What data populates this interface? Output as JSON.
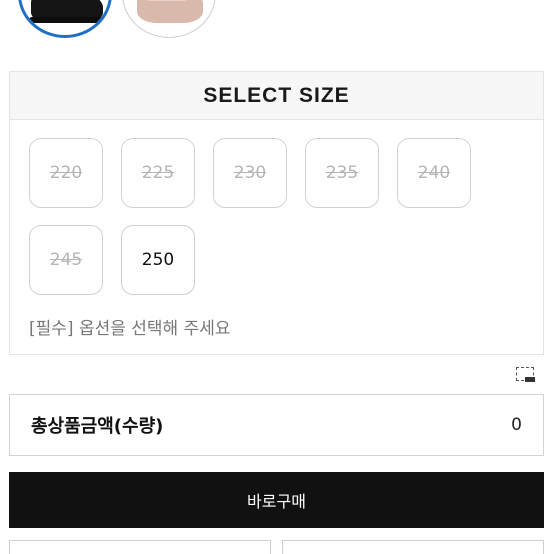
{
  "colors": {
    "selected_swatch_border": "#1f6fc5",
    "buy_button_bg": "#111111",
    "panel_header_bg": "#f7f7f7"
  },
  "swatches": [
    {
      "name": "black-shoe",
      "selected": true
    },
    {
      "name": "pink-shoe",
      "selected": false
    }
  ],
  "size_panel": {
    "title": "SELECT SIZE",
    "sizes": [
      {
        "label": "220",
        "sold_out": true
      },
      {
        "label": "225",
        "sold_out": true
      },
      {
        "label": "230",
        "sold_out": true
      },
      {
        "label": "235",
        "sold_out": true
      },
      {
        "label": "240",
        "sold_out": true
      },
      {
        "label": "245",
        "sold_out": true
      },
      {
        "label": "250",
        "sold_out": false
      }
    ],
    "notice": "[필수] 옵션을 선택해 주세요"
  },
  "total": {
    "label": "총상품금액(수량)",
    "value": "0"
  },
  "buy_button": {
    "label": "바로구매"
  }
}
